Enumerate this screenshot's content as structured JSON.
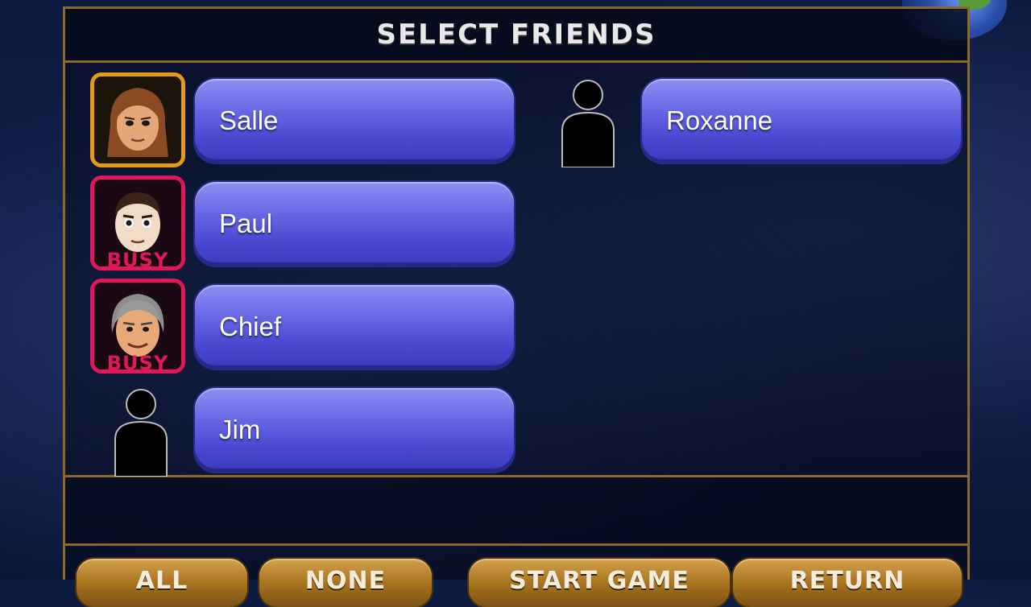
{
  "header": {
    "title": "SELECT FRIENDS"
  },
  "friends": [
    {
      "name": "Salle",
      "status": "selected",
      "avatar": "mii-avatar-salle"
    },
    {
      "name": "Paul",
      "status": "busy",
      "status_label": "BUSY",
      "avatar": "mii-avatar-paul"
    },
    {
      "name": "Chief",
      "status": "busy",
      "status_label": "BUSY",
      "avatar": "mii-avatar-chief"
    },
    {
      "name": "Jim",
      "status": "none",
      "avatar": "silhouette-icon"
    },
    {
      "name": "Roxanne",
      "status": "none",
      "avatar": "silhouette-icon"
    }
  ],
  "buttons": {
    "all": "ALL",
    "none": "NONE",
    "start_game": "START GAME",
    "return": "RETURN"
  },
  "colors": {
    "selected_border": "#e39a19",
    "busy": "#e0175a",
    "name_button": "#5a5ade",
    "panel_border": "#8a6a28"
  }
}
